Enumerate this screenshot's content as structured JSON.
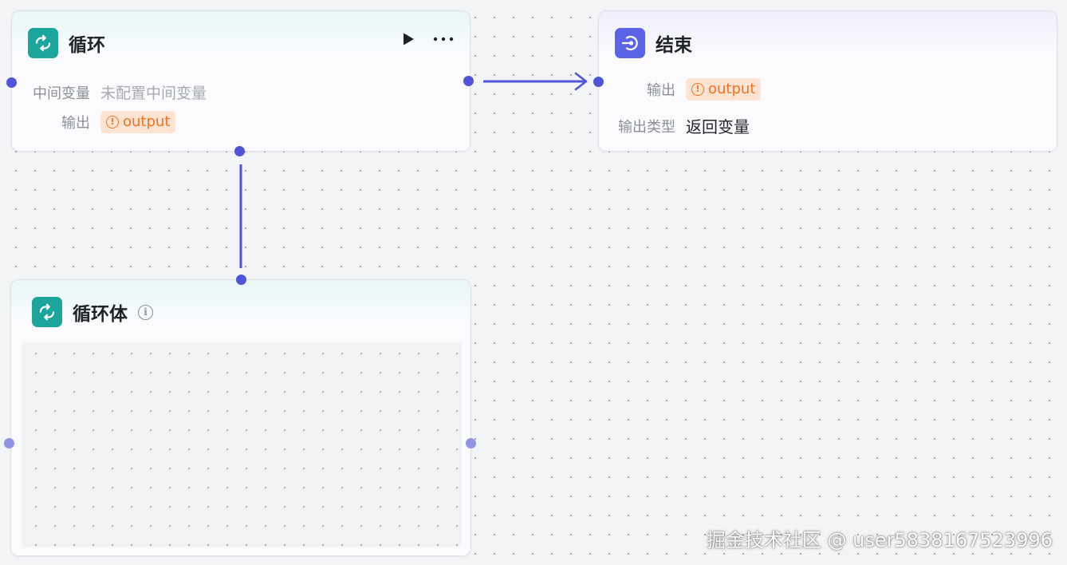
{
  "loop_node": {
    "title": "循环",
    "icon": "loop-icon",
    "actions": [
      {
        "name": "run-button",
        "icon": "play-icon"
      },
      {
        "name": "more-button",
        "icon": "more-horizontal-icon"
      }
    ],
    "fields": {
      "intermediate_label": "中间变量",
      "intermediate_value": "未配置中间变量",
      "output_label": "输出",
      "output_value": "output"
    },
    "colors": {
      "icon_bg": "#1ca59d"
    }
  },
  "end_node": {
    "title": "结束",
    "icon": "end-icon",
    "fields": {
      "output_label": "输出",
      "output_value": "output",
      "output_type_label": "输出类型",
      "output_type_value": "返回变量"
    },
    "colors": {
      "icon_bg": "#5b63e6"
    }
  },
  "loop_body_node": {
    "title": "循环体",
    "icon": "loop-icon",
    "info_icon": "info-icon",
    "colors": {
      "icon_bg": "#1ca59d"
    }
  },
  "badge": {
    "icon": "warning-circle-icon",
    "colors": {
      "bg": "#fde3d2",
      "text": "#f0721f"
    }
  },
  "edge_color": "#4f55d6",
  "watermark": "掘金技术社区 @ user5838167523996"
}
